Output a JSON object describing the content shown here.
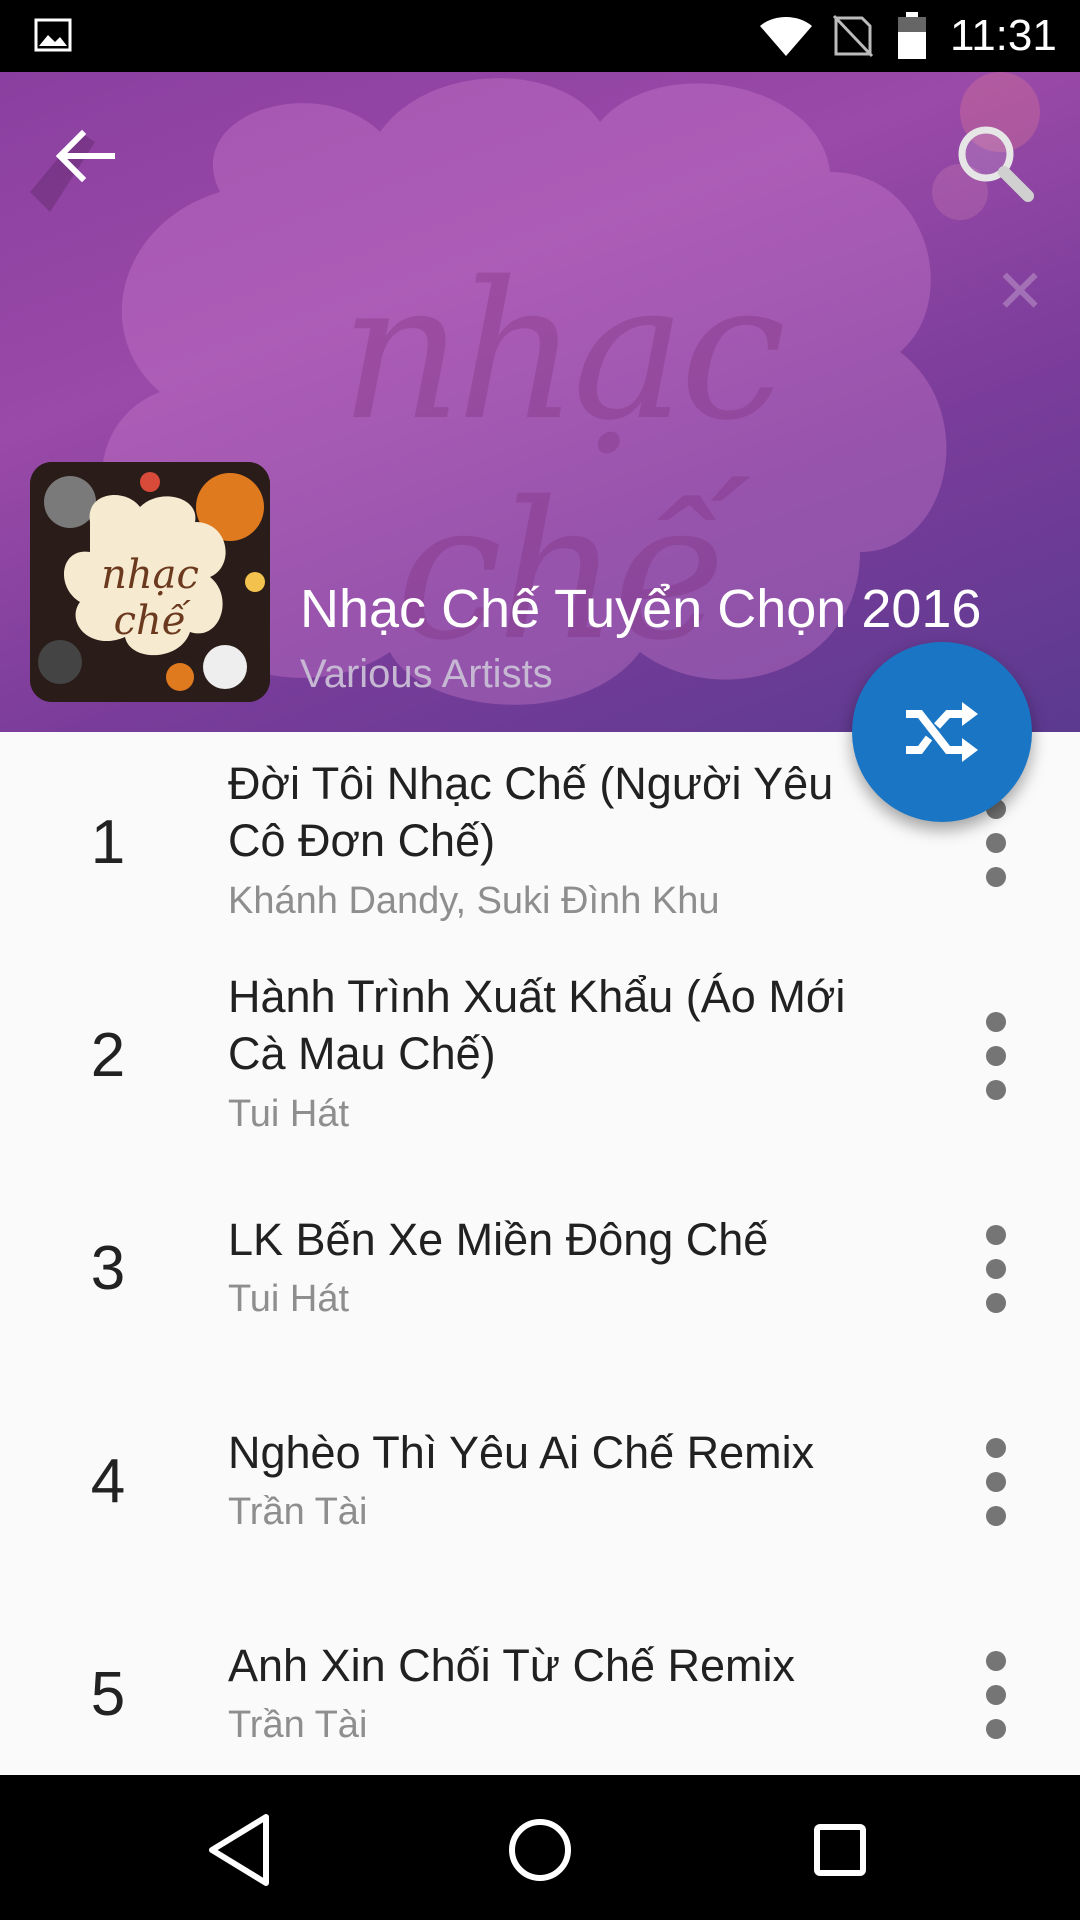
{
  "status_bar": {
    "time": "11:31"
  },
  "header": {
    "watermark": "nhạc chế",
    "album_art_text": "nhạc chế",
    "album_title": "Nhạc Chế Tuyển Chọn 2016",
    "album_artist": "Various Artists"
  },
  "icons": {
    "back": "arrow-left-icon",
    "search": "search-icon",
    "shuffle": "shuffle-icon",
    "more": "more-vert-icon",
    "nav_back": "triangle-back-icon",
    "nav_home": "circle-home-icon",
    "nav_recents": "square-recents-icon"
  },
  "colors": {
    "fab": "#1a76c4",
    "header_gradient_start": "#8a3fa0",
    "header_gradient_end": "#5b3a8f"
  },
  "tracks": [
    {
      "number": "1",
      "title": "Đời Tôi Nhạc Chế (Người Yêu Cô Đơn Chế)",
      "artist": "Khánh Dandy, Suki Đình Khu"
    },
    {
      "number": "2",
      "title": "Hành Trình Xuất Khẩu (Áo Mới Cà Mau Chế)",
      "artist": "Tui Hát"
    },
    {
      "number": "3",
      "title": "LK Bến Xe Miền Đông Chế",
      "artist": "Tui Hát"
    },
    {
      "number": "4",
      "title": "Nghèo Thì Yêu Ai Chế Remix",
      "artist": "Trần Tài"
    },
    {
      "number": "5",
      "title": "Anh Xin Chối Từ Chế Remix",
      "artist": "Trần Tài"
    }
  ]
}
